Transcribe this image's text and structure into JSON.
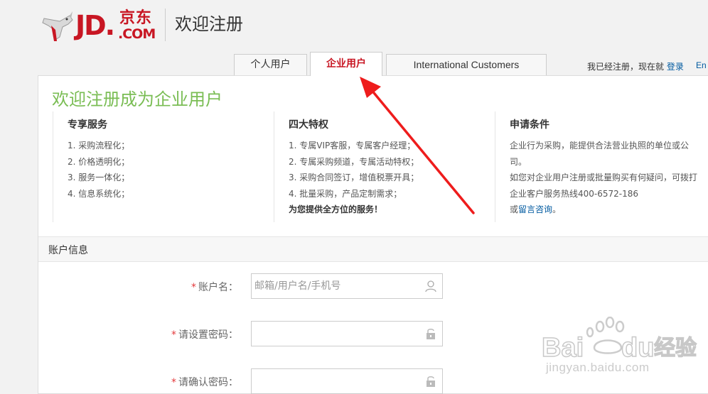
{
  "header": {
    "logo_jd": "JD.",
    "logo_cn": "京东",
    "logo_com": ".COM",
    "title": "欢迎注册"
  },
  "tabs": [
    {
      "label": "个人用户",
      "active": false
    },
    {
      "label": "企业用户",
      "active": true
    },
    {
      "label": "International Customers",
      "active": false
    }
  ],
  "login": {
    "hint": "我已经注册，现在就",
    "link": "登录",
    "lang": "En"
  },
  "panel": {
    "title": "欢迎注册成为企业用户",
    "columns": [
      {
        "heading": "专享服务",
        "items": [
          "1. 采购流程化；",
          "2. 价格透明化；",
          "3. 服务一体化；",
          "4. 信息系统化；"
        ]
      },
      {
        "heading": "四大特权",
        "items": [
          "1. 专属VIP客服，专属客户经理；",
          "2. 专属采购频道，专属活动特权；",
          "3. 采购合同签订，增值税票开具；",
          "4. 批量采购，产品定制需求；"
        ],
        "footer": "为您提供全方位的服务！"
      },
      {
        "heading": "申请条件",
        "lines": [
          "企业行为采购，能提供合法营业执照的单位或公",
          "司。",
          "如您对企业用户注册或批量购买有何疑问，可拨打",
          "企业客户服务热线400-6572-186"
        ],
        "last_prefix": "或",
        "last_link": "留言咨询",
        "last_suffix": "。"
      }
    ]
  },
  "account": {
    "section_label": "账户信息",
    "fields": [
      {
        "required": "*",
        "label": "账户名：",
        "placeholder": "邮箱/用户名/手机号",
        "icon": "user-icon"
      },
      {
        "required": "*",
        "label": "请设置密码：",
        "placeholder": "",
        "icon": "lock-icon"
      },
      {
        "required": "*",
        "label": "请确认密码：",
        "placeholder": "",
        "icon": "lock-icon"
      }
    ]
  },
  "watermark": {
    "brand": "Bai",
    "brand2": "du",
    "jingyan": "经验",
    "url": "jingyan.baidu.com"
  },
  "colors": {
    "brand_red": "#c81623",
    "title_green": "#7abd54",
    "link_blue": "#005aa0",
    "arrow_red": "#ee1c1c"
  }
}
